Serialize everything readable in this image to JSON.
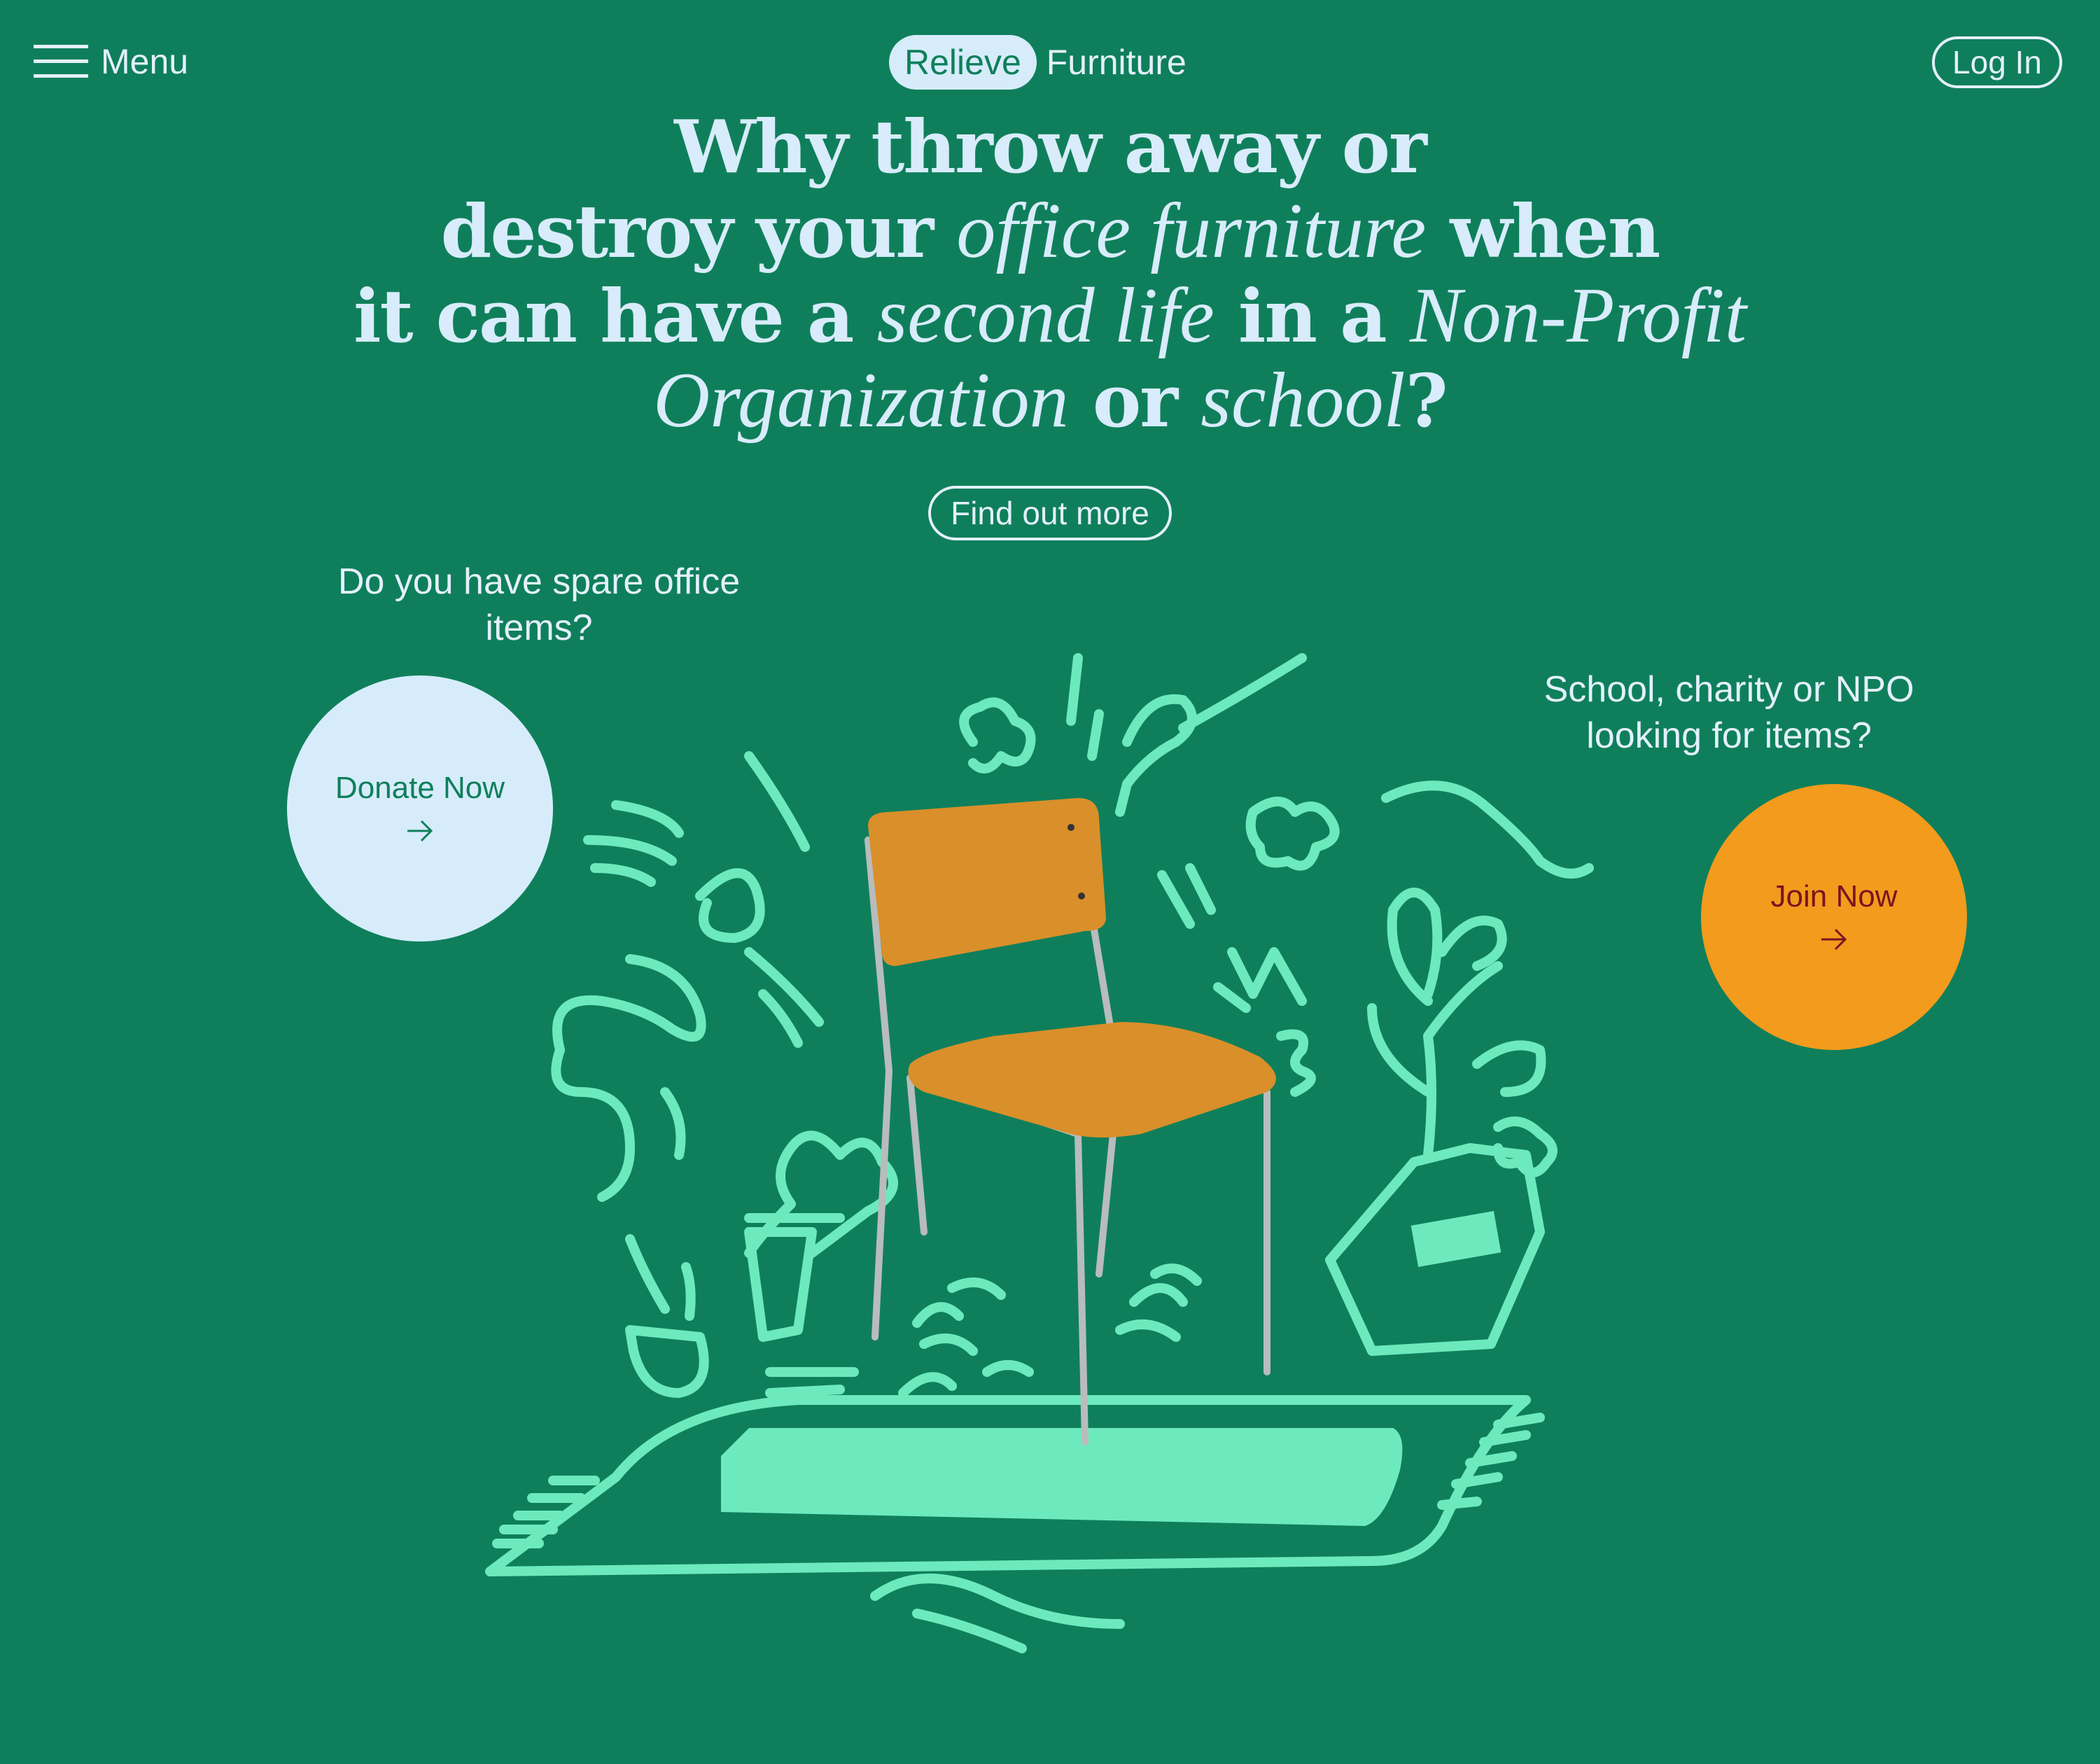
{
  "nav": {
    "menu_label": "Menu",
    "logo_highlight": "Relieve",
    "logo_rest": "Furniture",
    "login_label": "Log In"
  },
  "hero": {
    "line1": "Why throw away or",
    "line2_a": "destroy your ",
    "line2_em": "office furniture",
    "line2_b": " when",
    "line3_a": "it can have a ",
    "line3_em1": "second life",
    "line3_b": " in a ",
    "line3_em2": "Non-Profit",
    "line4_em1": "Organization",
    "line4_a": " or ",
    "line4_em2": "school",
    "line4_b": "?",
    "cta_label": "Find out more"
  },
  "donate": {
    "question": "Do you have spare office items?",
    "button_label": "Donate Now",
    "icon": "arrow-right-icon"
  },
  "join": {
    "question": "School, charity or NPO looking for items?",
    "button_label": "Join Now",
    "icon": "arrow-right-icon"
  },
  "illustration": {
    "subject": "chair-with-doodles",
    "colors": {
      "background": "#0f7f5b",
      "doodle": "#6ceabd",
      "chair_wood": "#d98f2a",
      "chair_frame": "#b8bcbc"
    }
  },
  "colors": {
    "background": "#0f7f5b",
    "text_light": "#d8ecfb",
    "donate_bg": "#d6ecfb",
    "join_bg": "#f29b1d",
    "join_text": "#7a1420"
  }
}
